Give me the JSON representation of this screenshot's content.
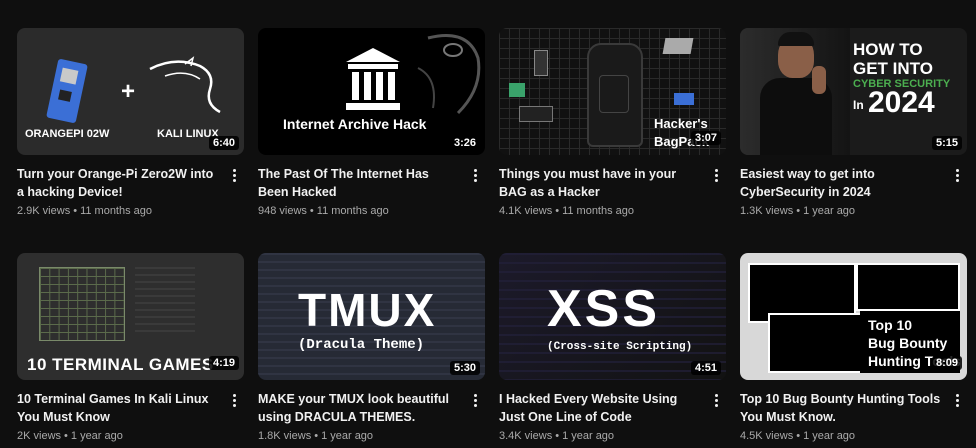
{
  "videos": [
    {
      "title": "Turn your Orange-Pi Zero2W into a hacking Device!",
      "views": "2.9K views",
      "age": "11 months ago",
      "duration": "6:40",
      "thumb": {
        "left": "ORANGEPI 02W",
        "right": "KALI LINUX",
        "plus": "+"
      }
    },
    {
      "title": "The Past Of The Internet Has Been Hacked",
      "views": "948 views",
      "age": "11 months ago",
      "duration": "3:26",
      "thumb": {
        "caption": "Internet Archive Hack"
      }
    },
    {
      "title": "Things you must have in your BAG as a Hacker",
      "views": "4.1K views",
      "age": "11 months ago",
      "duration": "3:07",
      "thumb": {
        "caption_1": "Hacker's",
        "caption_2": "BagPack"
      }
    },
    {
      "title": "Easiest way to get into CyberSecurity in 2024",
      "views": "1.3K views",
      "age": "1 year ago",
      "duration": "5:15",
      "thumb": {
        "line_1": "HOW TO",
        "line_2": "GET INTO",
        "line_3": "CYBER SECURITY",
        "line_4_small": "In",
        "line_4_big": "2024"
      }
    },
    {
      "title": "10 Terminal Games In Kali Linux You Must Know",
      "views": "2K views",
      "age": "1 year ago",
      "duration": "4:19",
      "thumb": {
        "caption": "10 TERMINAL GAMES"
      }
    },
    {
      "title": "MAKE your TMUX look beautiful using DRACULA THEMES.",
      "views": "1.8K views",
      "age": "1 year ago",
      "duration": "5:30",
      "thumb": {
        "big": "TMUX",
        "sub": "(Dracula Theme)"
      }
    },
    {
      "title": "I Hacked Every Website Using Just One Line of Code",
      "views": "3.4K views",
      "age": "1 year ago",
      "duration": "4:51",
      "thumb": {
        "big": "XSS",
        "sub": "(Cross-site Scripting)"
      }
    },
    {
      "title": "Top 10 Bug Bounty Hunting Tools You Must Know.",
      "views": "4.5K views",
      "age": "1 year ago",
      "duration": "8:09",
      "thumb": {
        "line_1": "Top 10",
        "line_2": "Bug Bounty",
        "line_3": "Hunting Tools"
      }
    }
  ],
  "separator": "•",
  "icons": {
    "more": "more-vert-icon"
  },
  "colors": {
    "background": "#0f0f0f",
    "text": "#f1f1f1",
    "meta": "#aaaaaa",
    "orange_pi": "#3b6fd6",
    "cyber_green": "#4caf50"
  }
}
